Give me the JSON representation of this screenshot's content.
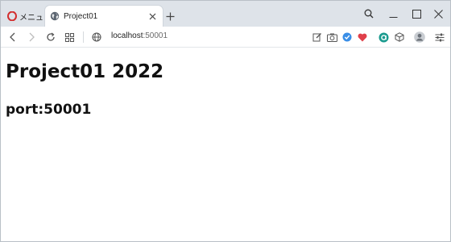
{
  "tabs": [
    {
      "label": "メニュー",
      "icon": "opera-icon",
      "active": false
    },
    {
      "label": "Project01",
      "icon": "globe-icon",
      "active": true
    }
  ],
  "address": {
    "host": "localhost",
    "port": ":50001"
  },
  "page": {
    "heading": "Project01 2022",
    "subheading": "port:50001"
  },
  "colors": {
    "accent_red": "#d32f2f",
    "tabstrip": "#dee3e9",
    "vpn_blue": "#3a8ee6",
    "heart_red": "#e0404a",
    "ext_teal": "#1b9b8f"
  }
}
